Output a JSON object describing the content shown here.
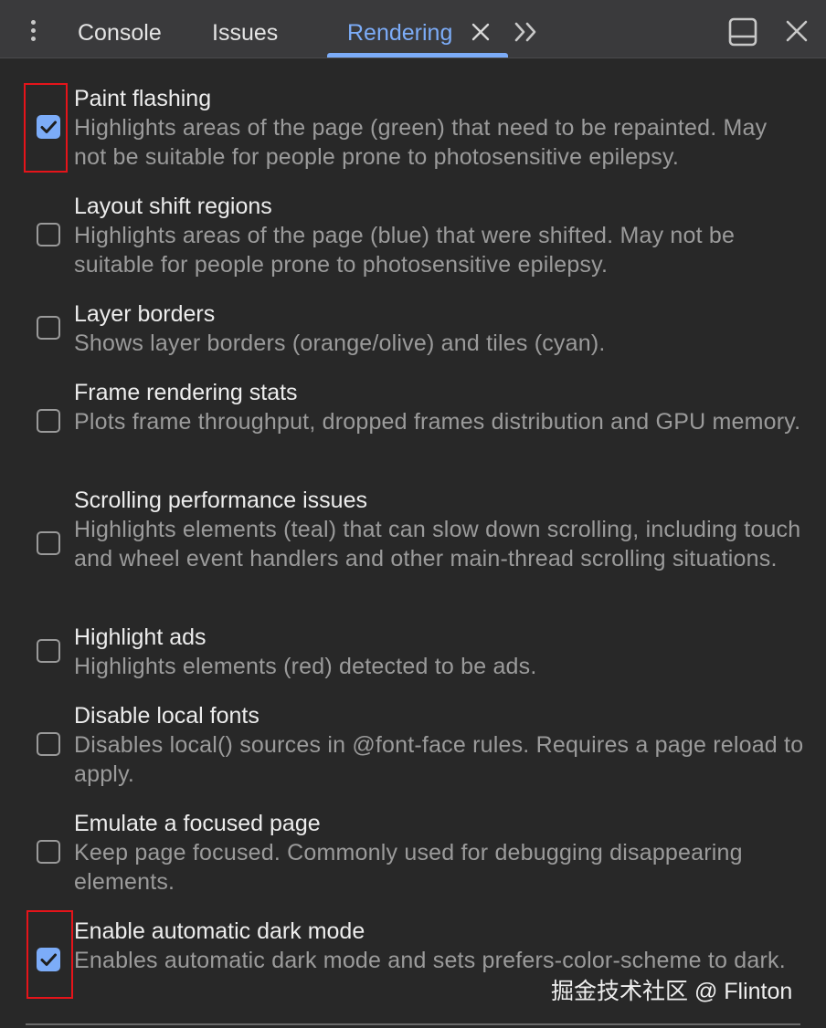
{
  "tabs": [
    {
      "label": "Console"
    },
    {
      "label": "Issues"
    },
    {
      "label": "Rendering",
      "active": true,
      "closable": true
    }
  ],
  "toolbar": {
    "menu_icon": "kebab-menu-icon",
    "overflow_icon": "double-chevron-right-icon",
    "dock_icon": "dock-side-icon",
    "close_icon": "close-icon"
  },
  "options": [
    {
      "title": "Paint flashing",
      "description": "Highlights areas of the page (green) that need to be repainted. May not be suitable for people prone to photosensitive epilepsy.",
      "checked": true,
      "highlighted": true
    },
    {
      "title": "Layout shift regions",
      "description": "Highlights areas of the page (blue) that were shifted. May not be suitable for people prone to photosensitive epilepsy.",
      "checked": false
    },
    {
      "title": "Layer borders",
      "description": "Shows layer borders (orange/olive) and tiles (cyan).",
      "checked": false
    },
    {
      "title": "Frame rendering stats",
      "description": "Plots frame throughput, dropped frames distribution and GPU memory.",
      "checked": false
    },
    {
      "title": "Scrolling performance issues",
      "description": "Highlights elements (teal) that can slow down scrolling, including touch and wheel event handlers and other main-thread scrolling situations.",
      "checked": false
    },
    {
      "title": "Highlight ads",
      "description": "Highlights elements (red) detected to be ads.",
      "checked": false
    },
    {
      "title": "Disable local fonts",
      "description": "Disables local() sources in @font-face rules. Requires a page reload to apply.",
      "checked": false
    },
    {
      "title": "Emulate a focused page",
      "description": "Keep page focused. Commonly used for debugging disappearing elements.",
      "checked": false
    },
    {
      "title": "Enable automatic dark mode",
      "description": "Enables automatic dark mode and sets prefers-color-scheme to dark.",
      "checked": true,
      "highlighted": true
    }
  ],
  "watermark": "掘金技术社区 @ Flinton",
  "colors": {
    "accent": "#7cacf8",
    "highlight_box": "#e5141a",
    "background": "#282828",
    "tabbar": "#3a3a3c"
  }
}
